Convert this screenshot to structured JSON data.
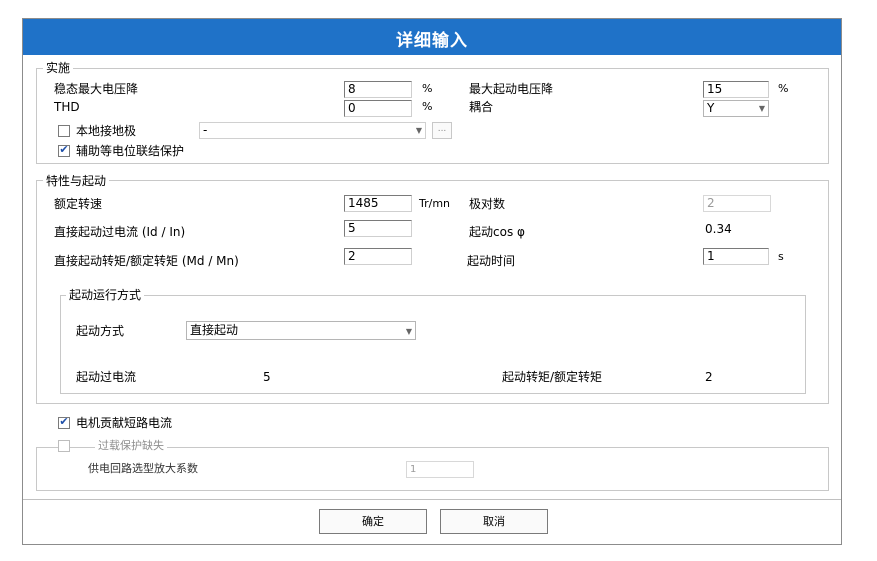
{
  "dialog": {
    "title": "详细输入"
  },
  "impl": {
    "legend": "实施",
    "max_steady_drop_label": "稳态最大电压降",
    "max_steady_drop_value": "8",
    "pct1": "%",
    "thd_label": "THD",
    "thd_value": "0",
    "pct2": "%",
    "max_start_drop_label": "最大起动电压降",
    "max_start_drop_value": "15",
    "pct3": "%",
    "coupling_label": "耦合",
    "coupling_value": "Y",
    "local_ground_label": "本地接地极",
    "local_ground_checked": false,
    "ground_combo_value": "-",
    "browse_label": "...",
    "aux_bond_label": "辅助等电位联结保护",
    "aux_bond_checked": true
  },
  "char": {
    "legend": "特性与起动",
    "rated_speed_label": "额定转速",
    "rated_speed_value": "1485",
    "rated_speed_unit": "Tr/mn",
    "poles_label": "极对数",
    "poles_value": "2",
    "dol_overcurrent_label": "直接起动过电流 (Id / In)",
    "dol_overcurrent_value": "5",
    "start_cos_label": "起动cos φ",
    "start_cos_value": "0.34",
    "dol_torque_label": "直接起动转矩/额定转矩 (Md / Mn)",
    "dol_torque_value": "2",
    "start_time_label": "起动时间",
    "start_time_value": "1",
    "start_time_unit": "s",
    "mode": {
      "legend": "起动运行方式",
      "method_label": "起动方式",
      "method_value": "直接起动",
      "overcurrent_label": "起动过电流",
      "overcurrent_value": "5",
      "torque_ratio_label": "起动转矩/额定转矩",
      "torque_ratio_value": "2"
    }
  },
  "motor_sc_label": "电机贡献短路电流",
  "motor_sc_checked": true,
  "overload": {
    "legend": "过载保护缺失",
    "checked": false,
    "factor_label": "供电回路选型放大系数",
    "factor_value": "1"
  },
  "buttons": {
    "ok": "确定",
    "cancel": "取消"
  }
}
